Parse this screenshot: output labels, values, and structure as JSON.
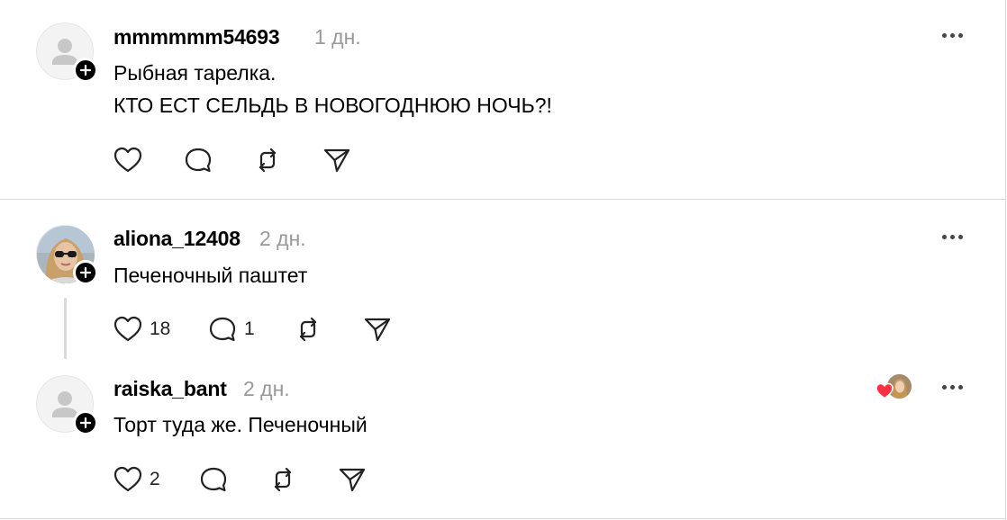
{
  "posts": [
    {
      "username": "mmmmmm54693",
      "time": "1 дн.",
      "lines": [
        "Рыбная тарелка.",
        "КТО ЕСТ СЕЛЬДЬ В НОВОГОДНЮЮ НОЧЬ?!"
      ],
      "likes": "",
      "replies": ""
    },
    {
      "username": "aliona_12408",
      "time": "2 дн.",
      "lines": [
        "Печеночный паштет"
      ],
      "likes": "18",
      "replies": "1"
    },
    {
      "username": "raiska_bant",
      "time": "2 дн.",
      "lines": [
        "Торт туда же. Печеночный"
      ],
      "likes": "2",
      "replies": ""
    }
  ],
  "icons": {
    "like": "heart-icon",
    "reply": "comment-icon",
    "repost": "repost-icon",
    "share": "send-icon",
    "more": "more-icon",
    "follow": "plus-icon",
    "liked_by": "red-heart-icon"
  },
  "colors": {
    "liked_heart": "#ff3040",
    "divider": "#d9d9d9",
    "meta": "#999999"
  }
}
